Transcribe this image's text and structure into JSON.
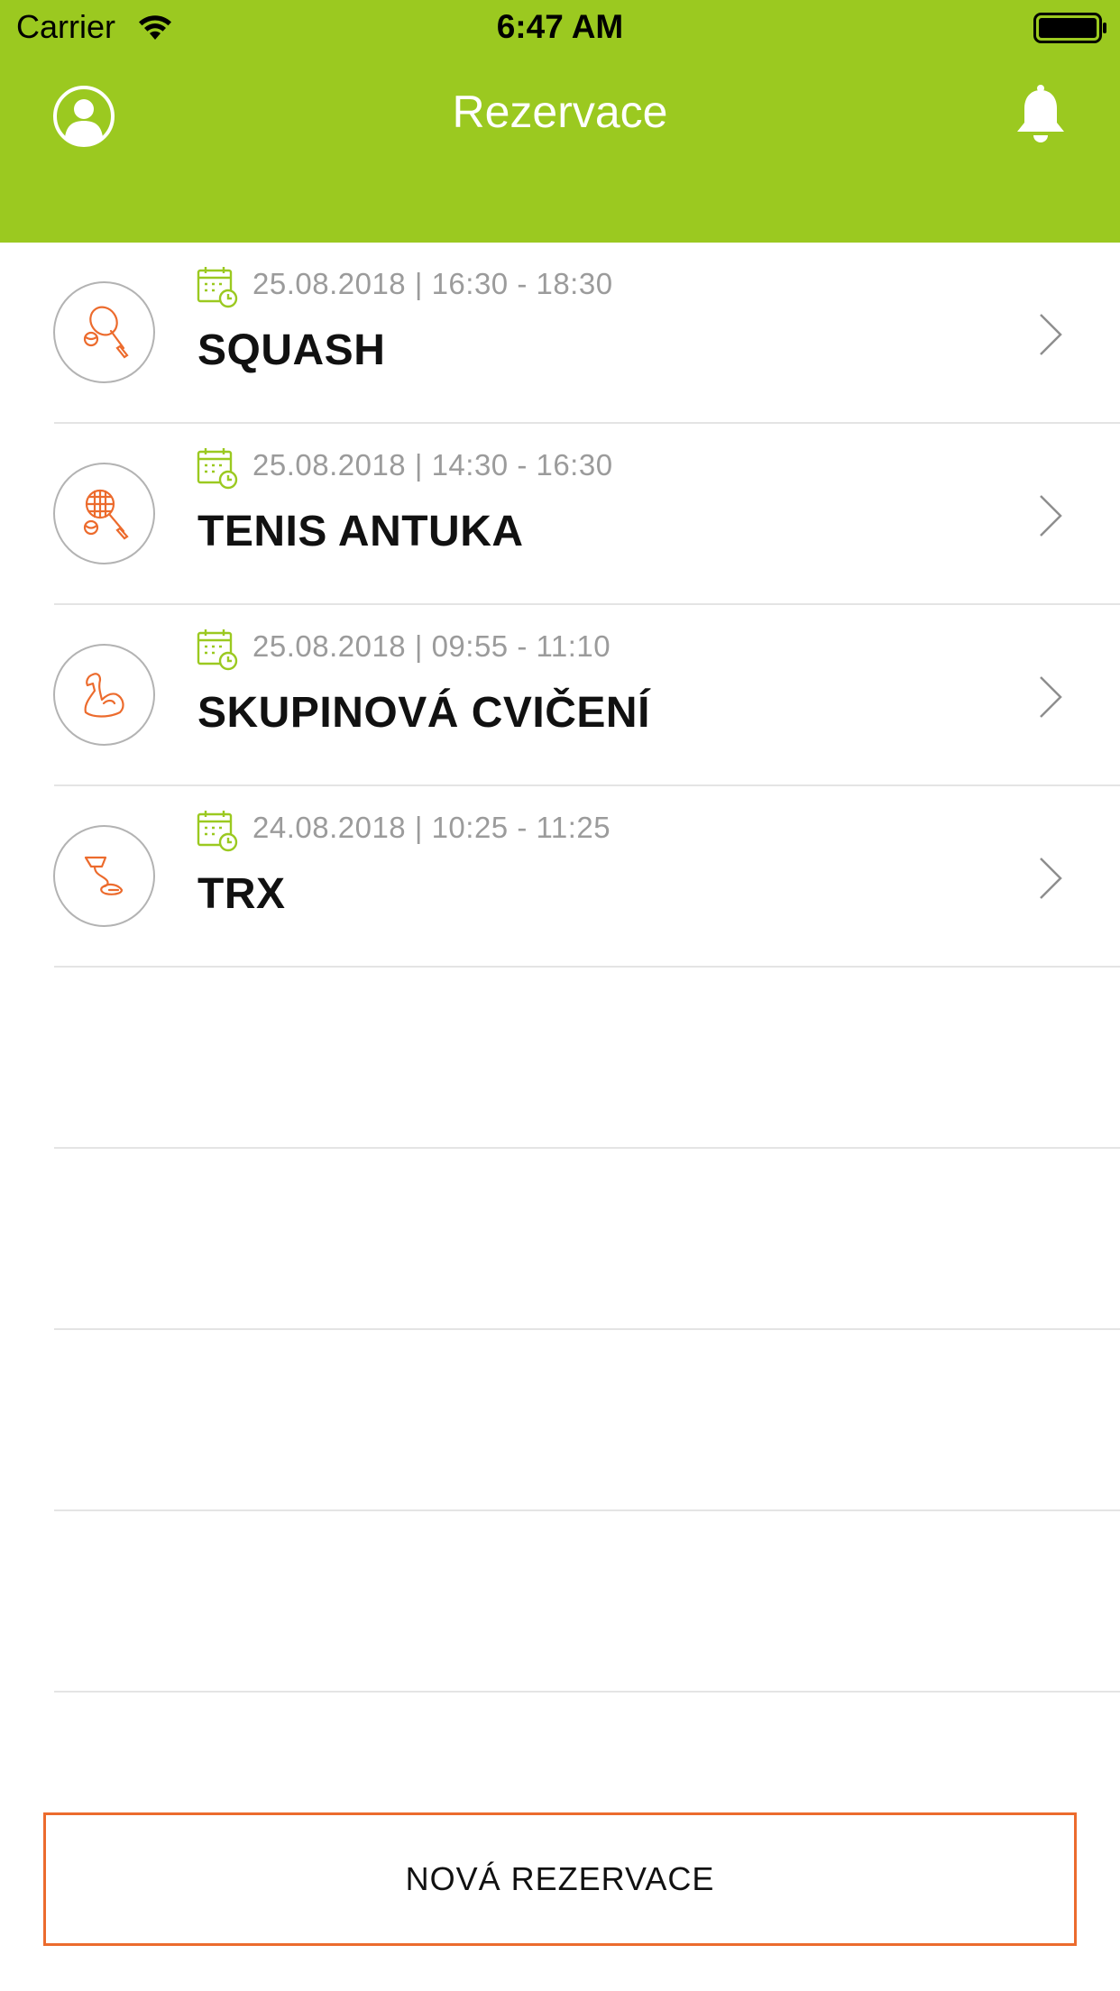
{
  "status_bar": {
    "carrier": "Carrier",
    "time": "6:47 AM",
    "wifi_icon": "wifi-icon",
    "battery_icon": "battery-full-icon"
  },
  "nav": {
    "title": "Rezervace",
    "left_icon": "user-profile-icon",
    "right_icon": "bell-icon"
  },
  "colors": {
    "header_bg": "#9bc920",
    "accent_orange": "#ec6b2d",
    "calendar_green": "#9bc920",
    "date_gray": "#9b9b9b"
  },
  "reservations": [
    {
      "date": "25.08.2018 | 16:30 - 18:30",
      "title": "SQUASH",
      "icon": "squash-racket-icon"
    },
    {
      "date": "25.08.2018 | 14:30 - 16:30",
      "title": "TENIS ANTUKA",
      "icon": "tennis-racket-icon"
    },
    {
      "date": "25.08.2018 | 09:55 - 11:10",
      "title": "SKUPINOVÁ CVIČENÍ",
      "icon": "flexed-biceps-icon"
    },
    {
      "date": "24.08.2018 | 10:25 - 11:25",
      "title": "TRX",
      "icon": "trx-strap-icon"
    }
  ],
  "empty_rows": 4,
  "footer": {
    "new_reservation_label": "NOVÁ REZERVACE"
  }
}
